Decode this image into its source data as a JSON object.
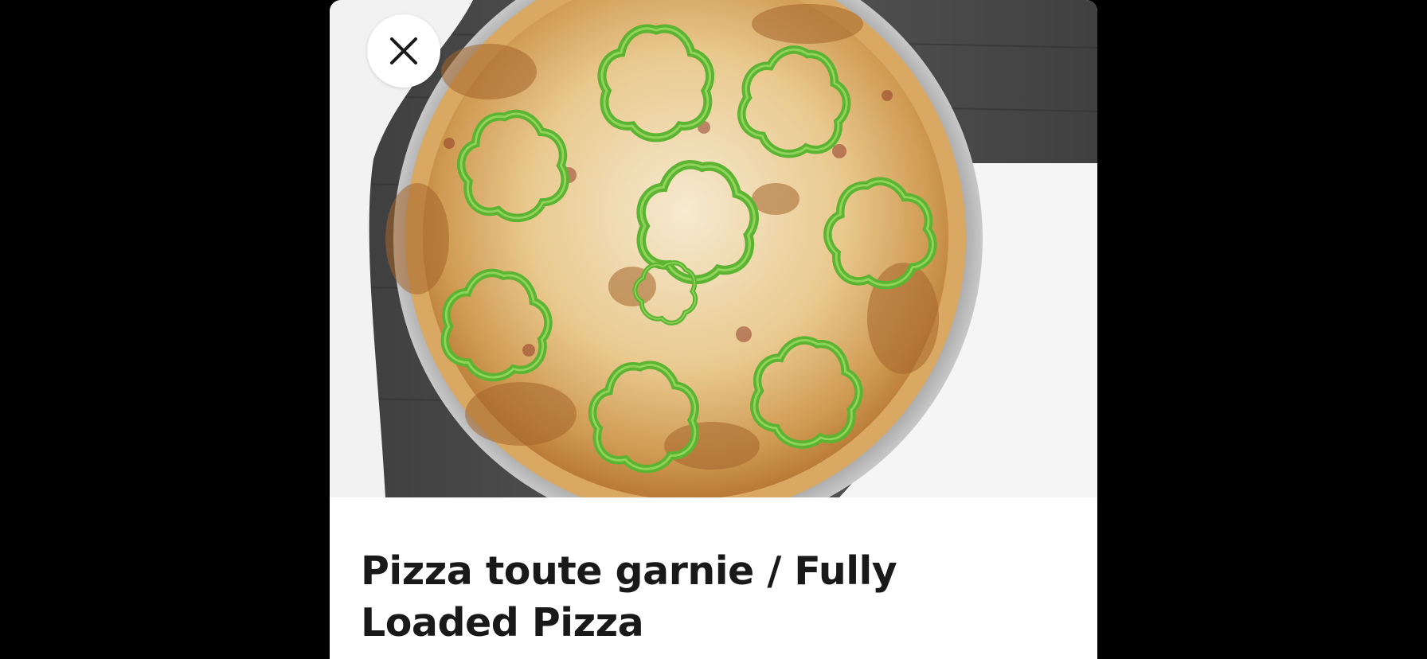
{
  "item": {
    "title": "Pizza toute garnie / Fully Loaded Pizza",
    "image": {
      "subject": "pizza with green bell pepper rings",
      "icon": "food-photo"
    }
  },
  "controls": {
    "close_icon": "close-icon"
  },
  "colors": {
    "backdrop": "#000000",
    "sheet": "#ffffff",
    "title_text": "#191919",
    "close_button_bg": "#ffffff",
    "pepper_green": "#5cb432",
    "crust": "#d9a862",
    "table": "#4a4a4a"
  }
}
